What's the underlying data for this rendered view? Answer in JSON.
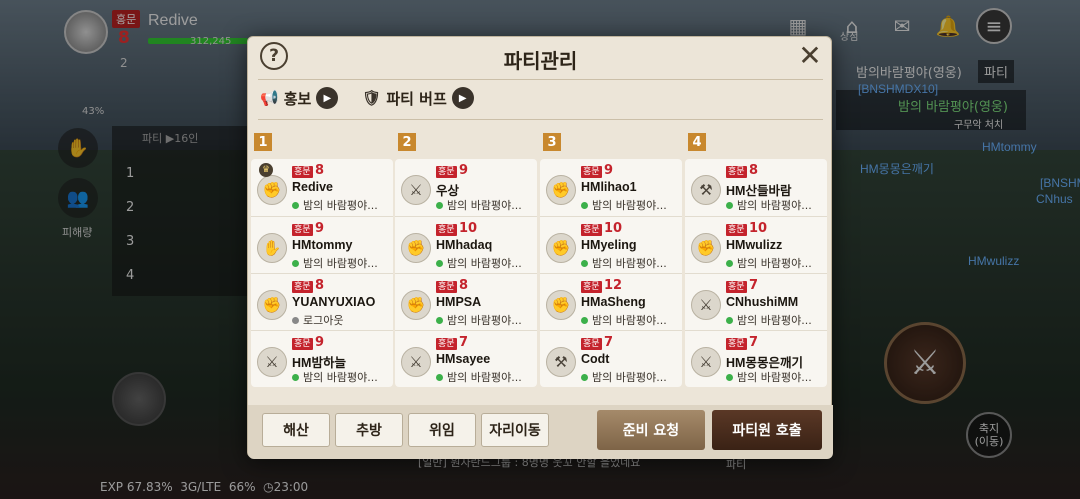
{
  "hud": {
    "honor_badge": "홍문",
    "level": "8",
    "player_name": "Redive",
    "hp": "312,245",
    "rank_number": "2",
    "buff_percent": "43%",
    "side_label": "피해량"
  },
  "left_party": {
    "header": "파티",
    "count": "16인",
    "rows": [
      "1",
      "2",
      "3",
      "4"
    ]
  },
  "top_right": {
    "shop_label": "상점",
    "zone_name": "밤의바람평야(영웅)",
    "zone_tab": "파티",
    "quest_title": "밤의 바람평야(영웅)",
    "quest_sub": "구무악 처치"
  },
  "world_tags": {
    "tag1": "[BNSHMDX10]",
    "tag2": "HMtommy",
    "tag3": "[BNSHM",
    "tag4": "CNhus",
    "tag5": "HMwulizz",
    "tag6": "HM몽몽은깨기"
  },
  "controls": {
    "shrink_label_1": "축지",
    "shrink_label_2": "(이동)"
  },
  "status": {
    "exp": "EXP 67.83%",
    "network": "3G/LTE",
    "battery": "66%",
    "clock": "23:00"
  },
  "chat": {
    "line": "[일반] 원자란드그룹 : 8명명 웃꼬 안할 을었네요",
    "tab": "파티"
  },
  "modal": {
    "title": "파티관리",
    "help_label": "?",
    "close_label": "✕",
    "promo_label": "홍보",
    "buff_label": "파티 버프",
    "parties": [
      {
        "number": "1",
        "members": [
          {
            "honor": "홍문",
            "level": "8",
            "name": "Redive",
            "status": "밤의 바람평야...",
            "online": true,
            "leader": true,
            "icon": "fist-icon"
          },
          {
            "honor": "홍문",
            "level": "9",
            "name": "HMtommy",
            "status": "밤의 바람평야...",
            "online": true,
            "leader": false,
            "icon": "gauntlet-icon"
          },
          {
            "honor": "홍문",
            "level": "8",
            "name": "YUANYUXIAO",
            "status": "로그아웃",
            "online": false,
            "leader": false,
            "icon": "fist-icon"
          },
          {
            "honor": "홍문",
            "level": "9",
            "name": "HM밤하늘",
            "status": "밤의 바람평야...",
            "online": true,
            "leader": false,
            "icon": "sword-icon"
          }
        ]
      },
      {
        "number": "2",
        "members": [
          {
            "honor": "홍문",
            "level": "9",
            "name": "우상",
            "status": "밤의 바람평야...",
            "online": true,
            "leader": false,
            "icon": "sword-icon"
          },
          {
            "honor": "홍문",
            "level": "10",
            "name": "HMhadaq",
            "status": "밤의 바람평야...",
            "online": true,
            "leader": false,
            "icon": "fist-icon"
          },
          {
            "honor": "홍문",
            "level": "8",
            "name": "HMPSA",
            "status": "밤의 바람평야...",
            "online": true,
            "leader": false,
            "icon": "fist-icon"
          },
          {
            "honor": "홍문",
            "level": "7",
            "name": "HMsayee",
            "status": "밤의 바람평야...",
            "online": true,
            "leader": false,
            "icon": "sword-icon"
          }
        ]
      },
      {
        "number": "3",
        "members": [
          {
            "honor": "홍문",
            "level": "9",
            "name": "HMlihao1",
            "status": "밤의 바람평야...",
            "online": true,
            "leader": false,
            "icon": "fist-icon"
          },
          {
            "honor": "홍문",
            "level": "10",
            "name": "HMyeling",
            "status": "밤의 바람평야...",
            "online": true,
            "leader": false,
            "icon": "fist-icon"
          },
          {
            "honor": "홍문",
            "level": "12",
            "name": "HMaSheng",
            "status": "밤의 바람평야...",
            "online": true,
            "leader": false,
            "icon": "fist-icon"
          },
          {
            "honor": "홍문",
            "level": "7",
            "name": "Codt",
            "status": "밤의 바람평야...",
            "online": true,
            "leader": false,
            "icon": "claw-icon"
          }
        ]
      },
      {
        "number": "4",
        "members": [
          {
            "honor": "홍문",
            "level": "8",
            "name": "HM산들바람",
            "status": "밤의 바람평야...",
            "online": true,
            "leader": false,
            "icon": "claw-icon"
          },
          {
            "honor": "홍문",
            "level": "10",
            "name": "HMwulizz",
            "status": "밤의 바람평야...",
            "online": true,
            "leader": false,
            "icon": "fist-icon"
          },
          {
            "honor": "홍문",
            "level": "7",
            "name": "CNhushiMM",
            "status": "밤의 바람평야...",
            "online": true,
            "leader": false,
            "icon": "sword-icon"
          },
          {
            "honor": "홍문",
            "level": "7",
            "name": "HM몽몽은깨기",
            "status": "밤의 바람평야...",
            "online": true,
            "leader": false,
            "icon": "sword-icon"
          }
        ]
      }
    ],
    "buttons": {
      "disband": "해산",
      "kick": "추방",
      "delegate": "위임",
      "move_seat": "자리이동",
      "ready_request": "준비 요청",
      "summon_members": "파티원 호출"
    }
  }
}
